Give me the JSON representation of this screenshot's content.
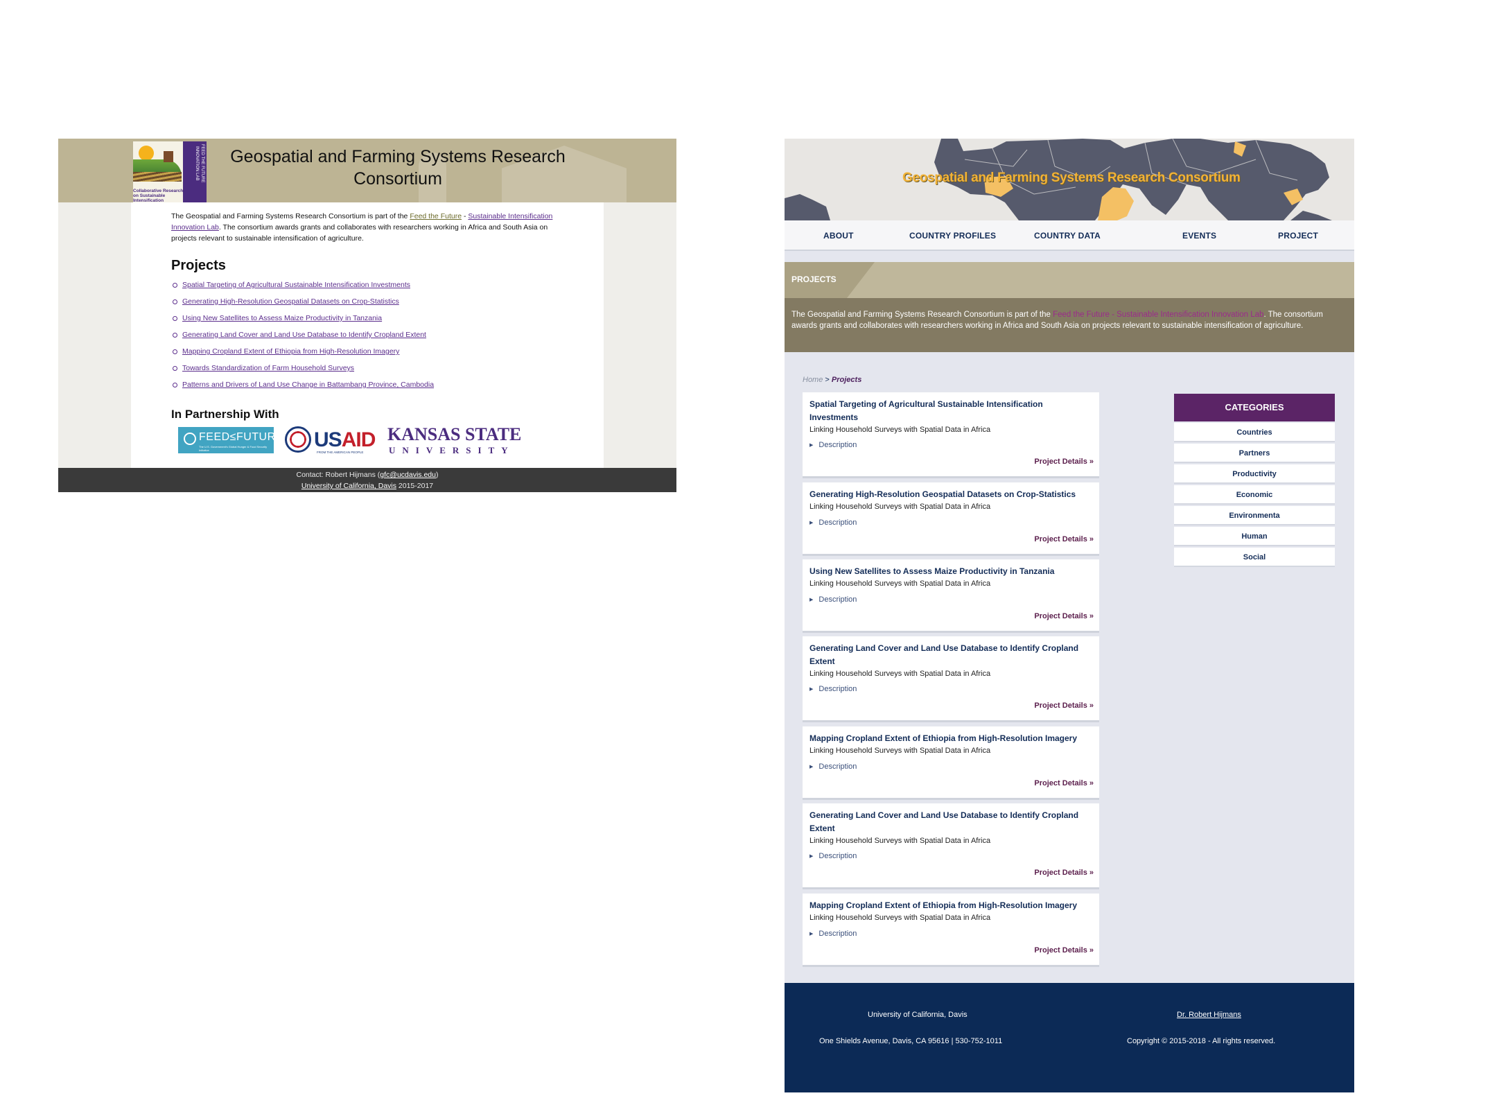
{
  "left": {
    "title": "Geospatial and Farming Systems Research Consortium",
    "logo": {
      "vertical": "FEED THE FUTURE INNOVATION LAB",
      "caption": "Collaborative Research on Sustainable Intensification"
    },
    "intro": {
      "part1": "The Geospatial and Farming Systems Research Consortium is part of the ",
      "link1": "Feed the Future",
      "sep": " - ",
      "link2": "Sustainable Intensification Innovation Lab",
      "part2": ". The consortium awards grants and collaborates with researchers working in Africa and South Asia on projects relevant to sustainable intensification of agriculture."
    },
    "projects_heading": "Projects",
    "projects": [
      "Spatial Targeting of Agricultural Sustainable Intensification Investments",
      "Generating High-Resolution Geospatial Datasets on Crop-Statistics",
      "Using New Satellites to Assess Maize Productivity in Tanzania",
      "Generating Land Cover and Land Use Database to Identify Cropland Extent",
      "Mapping Cropland Extent of Ethiopia from High-Resolution Imagery",
      "Towards Standardization of Farm Household Surveys",
      "Patterns and Drivers of Land Use Change in Battambang Province, Cambodia"
    ],
    "partnership_heading": "In Partnership With",
    "partners": {
      "ftf": "FEED≤FUTURE",
      "ftf_sub": "The U.S. Government's Global Hunger & Food Security Initiative",
      "usaid_us": "US",
      "usaid_aid": "AID",
      "usaid_sub": "FROM THE AMERICAN PEOPLE",
      "ksu": "KANSAS STATE",
      "ksu_sub": "UNIVERSITY"
    },
    "footer": {
      "contact_prefix": "Contact: Robert Hijmans (",
      "email": "gfc@ucdavis.edu",
      "contact_suffix": ")",
      "university": "University of California, Davis",
      "years": " 2015-2017"
    }
  },
  "right": {
    "title": "Geospatial and Farming Systems Research Consortium",
    "nav": [
      "ABOUT",
      "COUNTRY PROFILES",
      "COUNTRY DATA",
      "EVENTS",
      "PROJECT"
    ],
    "banner_label": "PROJECTS",
    "intro": {
      "part1": "The Geospatial and Farming Systems Research Consortium is part of the ",
      "link1": "Feed the Future",
      "sep": " - ",
      "link2": "Sustainable Intensification Innovation Lab",
      "part2": ". The consortium awards grants and collaborates with researchers working in Africa and South Asia on projects relevant to sustainable intensification of agriculture."
    },
    "breadcrumb": {
      "home": "Home",
      "sep": ">",
      "current": "Projects"
    },
    "cards": [
      {
        "title": "Spatial Targeting of Agricultural Sustainable Intensification Investments",
        "subtitle": "Linking Household Surveys with Spatial Data in Africa",
        "description": "Description",
        "details": "Project Details »"
      },
      {
        "title": "Generating High-Resolution Geospatial Datasets on Crop-Statistics",
        "subtitle": "Linking Household Surveys with Spatial Data in Africa",
        "description": "Description",
        "details": "Project Details »"
      },
      {
        "title": "Using New Satellites to Assess Maize Productivity in Tanzania",
        "subtitle": "Linking Household Surveys with Spatial Data in Africa",
        "description": "Description",
        "details": "Project Details »"
      },
      {
        "title": "Generating Land Cover and Land Use Database to Identify Cropland Extent",
        "subtitle": "Linking Household Surveys with Spatial Data in Africa",
        "description": "Description",
        "details": "Project Details »"
      },
      {
        "title": "Mapping Cropland Extent of Ethiopia from High-Resolution Imagery",
        "subtitle": "Linking Household Surveys with Spatial Data in Africa",
        "description": "Description",
        "details": "Project Details »"
      },
      {
        "title": "Generating Land Cover and Land Use Database to Identify Cropland Extent",
        "subtitle": "Linking Household Surveys with Spatial Data in Africa",
        "description": "Description",
        "details": "Project Details »"
      },
      {
        "title": "Mapping Cropland Extent of Ethiopia from High-Resolution Imagery",
        "subtitle": "Linking Household Surveys with Spatial Data in Africa",
        "description": "Description",
        "details": "Project Details »"
      }
    ],
    "categories": {
      "heading": "CATEGORIES",
      "items": [
        "Countries",
        "Partners",
        "Productivity",
        "Economic",
        "Environmenta",
        "Human",
        "Social"
      ]
    },
    "footer": {
      "university": "University of California, Davis",
      "address": "One Shields Avenue, Davis, CA 95616 | 530-752-1011",
      "person": "Dr. Robert Hijmans",
      "copyright": "Copyright © 2015-2018 - All rights reserved."
    },
    "colors": {
      "navy": "#0c2a56",
      "purple": "#5b2466",
      "gold": "#f2b236",
      "tan": "#aaa183"
    }
  }
}
